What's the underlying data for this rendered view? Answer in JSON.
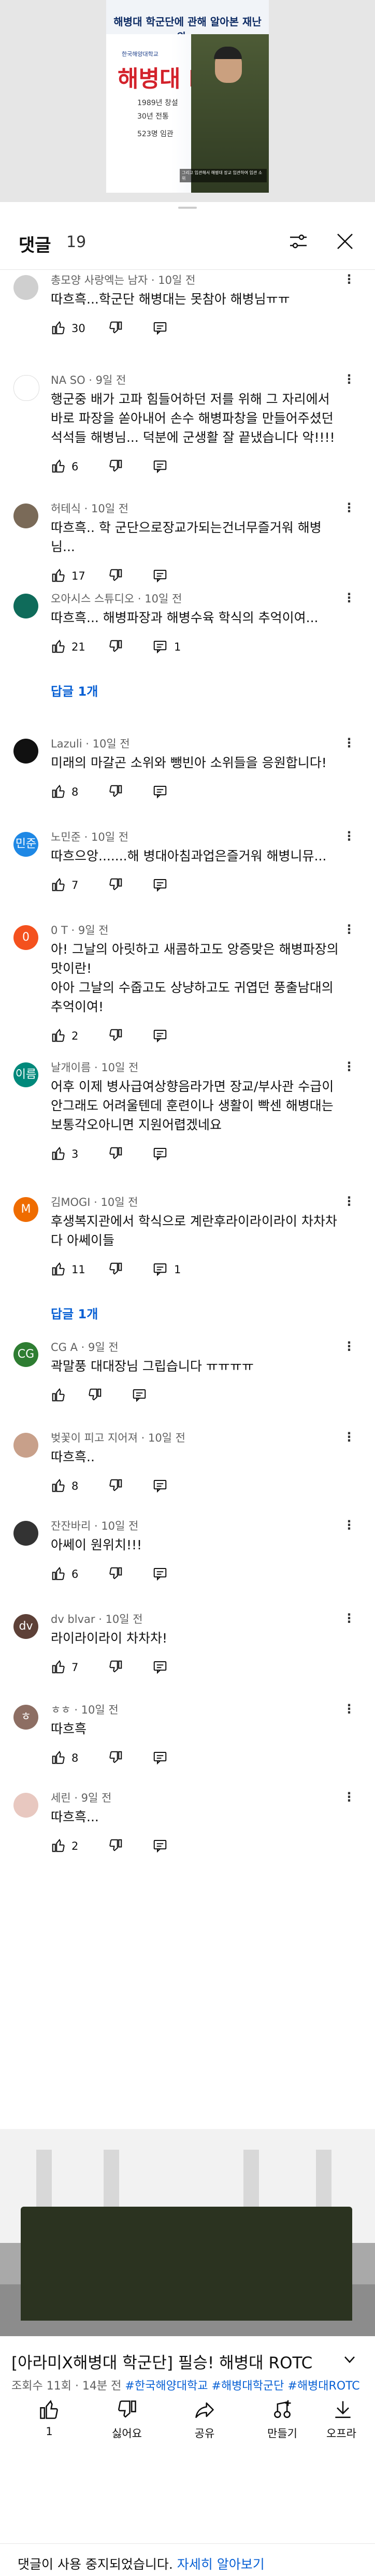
{
  "video": {
    "thumb_title": "해병대 학군단에 관해 알아본 재난와...",
    "thumb_sub": "한국해양대학교",
    "thumb_rotc": "해병대 ROTC",
    "thumb_info1": "1989년 창설",
    "thumb_info2": "30년 전통",
    "thumb_info3": "523명 임관",
    "thumb_caption": "그리고 임관해서 해병대 장교 임관하여 임관 소위",
    "title": "[아라미X해병대 학군단] 필승! 해병대 ROTC",
    "views": "조회수 11회 · 14분 전",
    "hashtags": "#한국해양대학교 #해병대학군단 #해병대ROTC",
    "like_count": "1",
    "dislike_label": "싫어요",
    "share_label": "공유",
    "create_label": "만들기",
    "offline_label": "오프라"
  },
  "comments_header": {
    "title": "댓글",
    "count": "19"
  },
  "comments": [
    {
      "author": "총모양 사랑엑는 남자",
      "time": "10일 전",
      "text": "따흐흑...학군단 해병대는 못참아 해병님ㅠㅠ",
      "likes": "30",
      "replies": "",
      "avatar_letter": "",
      "avatar_color": "#cfcfcf"
    },
    {
      "author": "NA SO",
      "time": "9일 전",
      "text": "행군중 배가 고파 힘들어하던 저를 위해 그 자리에서 바로 파장을 쏟아내어 손수 해병파창을 만들어주셨던 석석들 해병님... 덕분에 군생활 잘 끝냈습니다 악!!!!",
      "likes": "6",
      "replies": "",
      "avatar_letter": "",
      "avatar_color": "#ffffff"
    },
    {
      "author": "허테식",
      "time": "10일 전",
      "text": "따흐흑.. 학 군단으로장교가되는건너무즐거워 해병님...",
      "likes": "17",
      "replies": "",
      "avatar_letter": "",
      "avatar_color": "#7a6a58"
    },
    {
      "author": "오아시스 스튜디오",
      "time": "10일 전",
      "text": "따흐흑... 해병파장과 해병수육 학식의 추억이여...",
      "likes": "21",
      "replies": "1",
      "avatar_letter": "",
      "avatar_color": "#0f6b5a"
    },
    {
      "author": "Lazuli",
      "time": "10일 전",
      "text": "미래의 마갈곤 소위와 뺑빈아 소위들을 응원합니다!",
      "likes": "8",
      "replies": "",
      "avatar_letter": "",
      "avatar_color": "#111111"
    },
    {
      "author": "노민준",
      "time": "10일 전",
      "text": "따흐으앙.......해 병대아침과업은즐거워 해병니뮤...",
      "likes": "7",
      "replies": "",
      "avatar_letter": "민준",
      "avatar_color": "#1e88e5"
    },
    {
      "author": "0 T",
      "time": "9일 전",
      "text": "아! 그날의 아릿하고 새콤하고도 앙증맞은 해병파장의 맛이란!\n아아 그날의 수줍고도 상냥하고도 귀엽던 풍출남대의 추억이여!",
      "likes": "2",
      "replies": "",
      "avatar_letter": "0",
      "avatar_color": "#f4511e"
    },
    {
      "author": "날개이름",
      "time": "10일 전",
      "text": "어후 이제 병사급여상향음라가면 장교/부사관 수급이 안그래도 어려울텐데 훈련이나 생활이 빡센 해병대는 보통각오아니면 지원어렵겠네요",
      "likes": "3",
      "replies": "",
      "avatar_letter": "이름",
      "avatar_color": "#00897b"
    },
    {
      "author": "김MOGI",
      "time": "10일 전",
      "text": "후생복지관에서 학식으로 계란후라이라이라이 차차차다 아쎄이들",
      "likes": "11",
      "replies": "1",
      "avatar_letter": "M",
      "avatar_color": "#ef6c00"
    },
    {
      "author": "CG A",
      "time": "9일 전",
      "text": "곽말풍 대대장님 그립습니다 ㅠㅠㅠㅠ",
      "likes": "",
      "replies": "",
      "avatar_letter": "CG",
      "avatar_color": "#2e7d32"
    },
    {
      "author": "벚꽃이 피고 지어져",
      "time": "10일 전",
      "text": "따흐흑..",
      "likes": "8",
      "replies": "",
      "avatar_letter": "",
      "avatar_color": "#c8a08a"
    },
    {
      "author": "잔잔바리",
      "time": "10일 전",
      "text": "아쎄이 원위치!!!",
      "likes": "6",
      "replies": "",
      "avatar_letter": "",
      "avatar_color": "#333333"
    },
    {
      "author": "dv blvar",
      "time": "10일 전",
      "text": "라이라이라이 차차차!",
      "likes": "7",
      "replies": "",
      "avatar_letter": "dv",
      "avatar_color": "#5d4037"
    },
    {
      "author": "ㅎㅎ",
      "time": "10일 전",
      "text": "따흐흑",
      "likes": "8",
      "replies": "",
      "avatar_letter": "ㅎ",
      "avatar_color": "#8d6e63"
    },
    {
      "author": "세린",
      "time": "9일 전",
      "text": "따흐흑...",
      "likes": "2",
      "replies": "",
      "avatar_letter": "",
      "avatar_color": "#e8c8c0"
    }
  ],
  "reply_links": [
    "답글 1개",
    "답글 1개"
  ],
  "disabled": {
    "text": "댓글이 사용 중지되었습니다.",
    "link": "자세히 알아보기"
  }
}
